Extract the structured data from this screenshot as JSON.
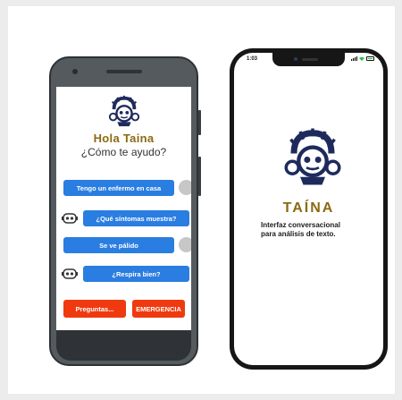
{
  "android": {
    "title": "Hola Taina",
    "subtitle": "¿Cómo te ayudo?",
    "messages": [
      "Tengo un enfermo en casa",
      "¿Qué síntomas muestra?",
      "Se ve pálido",
      "¿Respira bien?"
    ],
    "actions": [
      "Preguntas...",
      "EMERGENCIA"
    ],
    "colors": {
      "bubble": "#2a7de1",
      "action": "#ef3a10",
      "brand": "#8a6a12",
      "logo": "#1f2a5c"
    }
  },
  "iphone": {
    "time": "1:03",
    "brand": "TAÍNA",
    "description_line1": "Interfaz conversacional",
    "description_line2": "para análisis de texto."
  },
  "icons": [
    "taina-logo-icon",
    "bot-icon",
    "signal-icon",
    "wifi-icon",
    "battery-icon"
  ]
}
